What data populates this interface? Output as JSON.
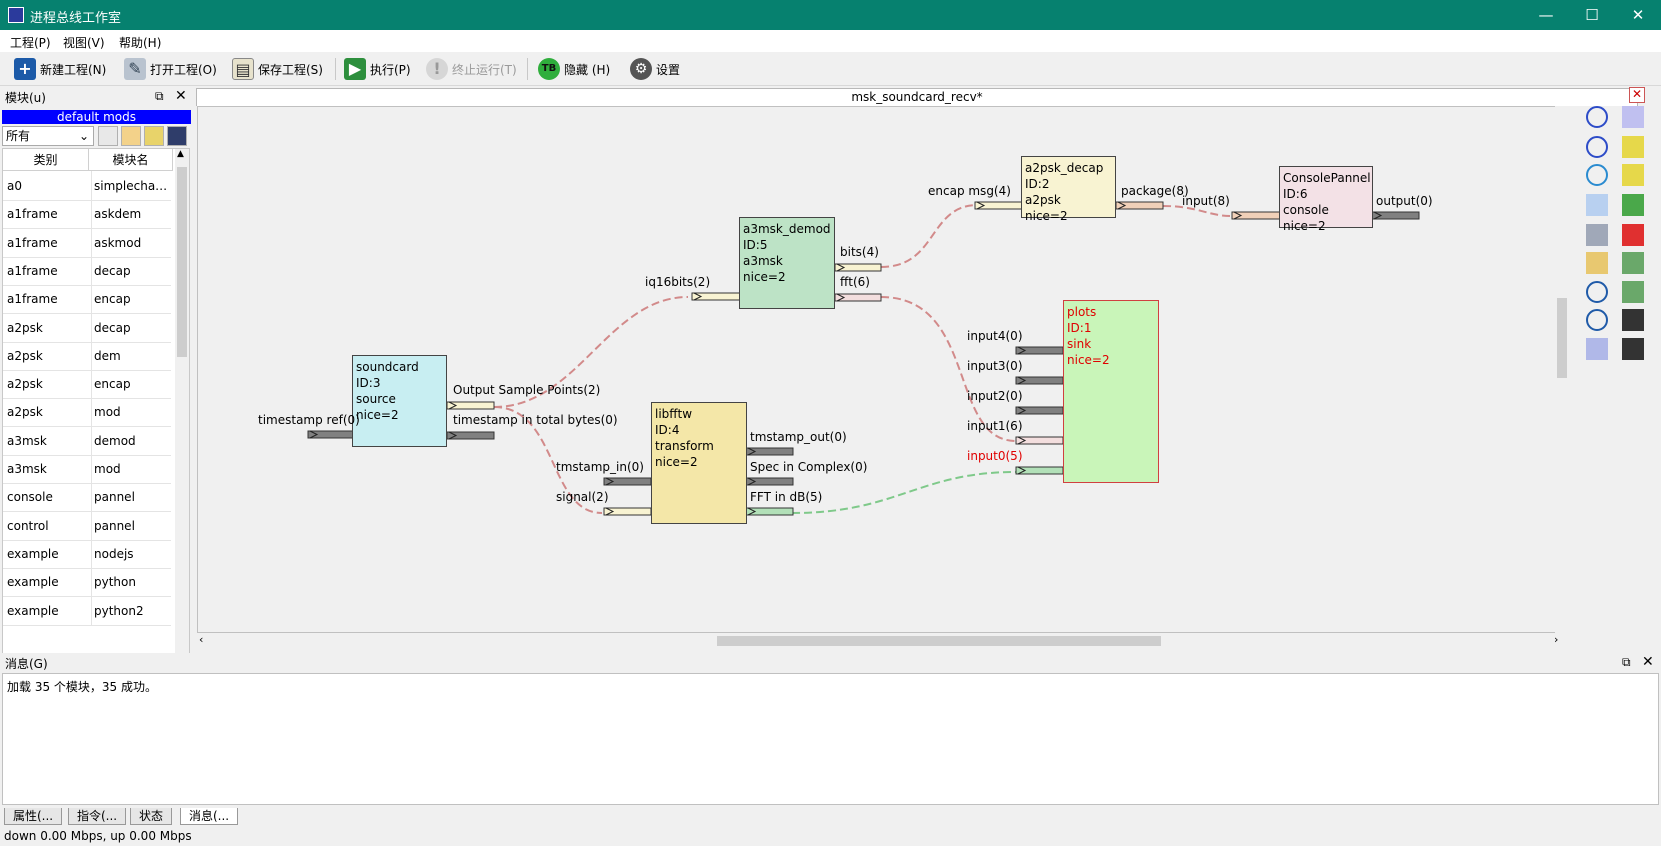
{
  "window": {
    "title": "进程总线工作室"
  },
  "menu": [
    "工程(P)",
    "视图(V)",
    "帮助(H)"
  ],
  "toolbar": {
    "new": "新建工程(N)",
    "open": "打开工程(O)",
    "save": "保存工程(S)",
    "run": "执行(P)",
    "stop": "终止运行(T)",
    "hide_icon_text": "TB",
    "hide": "隐藏  (H)",
    "settings": "设置"
  },
  "leftdock": {
    "title": "模块(u)",
    "group": "default mods",
    "filter": "所有",
    "columns": [
      "类别",
      "模块名"
    ],
    "rows": [
      [
        "a0",
        "simplechan..."
      ],
      [
        "a1frame",
        "askdem"
      ],
      [
        "a1frame",
        "askmod"
      ],
      [
        "a1frame",
        "decap"
      ],
      [
        "a1frame",
        "encap"
      ],
      [
        "a2psk",
        "decap"
      ],
      [
        "a2psk",
        "dem"
      ],
      [
        "a2psk",
        "encap"
      ],
      [
        "a2psk",
        "mod"
      ],
      [
        "a3msk",
        "demod"
      ],
      [
        "a3msk",
        "mod"
      ],
      [
        "console",
        "pannel"
      ],
      [
        "control",
        "pannel"
      ],
      [
        "example",
        "nodejs"
      ],
      [
        "example",
        "python"
      ],
      [
        "example",
        "python2"
      ]
    ]
  },
  "editor": {
    "tab_title": "msk_soundcard_recv*",
    "nodes": {
      "soundcard": [
        "soundcard",
        "ID:3",
        "source",
        "nice=2"
      ],
      "a3msk": [
        "a3msk_demod",
        "ID:5",
        "a3msk",
        "nice=2"
      ],
      "a2psk": [
        "a2psk_decap",
        "ID:2",
        "a2psk",
        "nice=2"
      ],
      "console": [
        "ConsolePannel",
        "ID:6",
        "console",
        "nice=2"
      ],
      "libfftw": [
        "libfftw",
        "ID:4",
        "transform",
        "nice=2"
      ],
      "plots": [
        "plots",
        "ID:1",
        "sink",
        "nice=2"
      ]
    },
    "ports": {
      "sc_in": "timestamp ref(0)",
      "sc_out1": "Output Sample Points(2)",
      "sc_out2": "timestamp in total bytes(0)",
      "a3_in": "iq16bits(2)",
      "a3_out1": "bits(4)",
      "a3_out2": "fft(6)",
      "a2_in": "encap msg(4)",
      "a2_out": "package(8)",
      "cp_in": "input(8)",
      "cp_out": "output(0)",
      "fft_in1": "tmstamp_in(0)",
      "fft_in2": "signal(2)",
      "fft_out1": "tmstamp_out(0)",
      "fft_out2": "Spec in Complex(0)",
      "fft_out3": "FFT in dB(5)",
      "pl_in4": "input4(0)",
      "pl_in3": "input3(0)",
      "pl_in2": "input2(0)",
      "pl_in1": "input1(6)",
      "pl_in0": "input0(5)"
    }
  },
  "messages": {
    "title": "消息(G)",
    "text": "加载 35 个模块，35 成功。"
  },
  "bottom_tabs": [
    "属性(...",
    "指令(...",
    "状态",
    "消息(..."
  ],
  "status": "down 0.00 Mbps, up 0.00 Mbps",
  "colors": {
    "titlebar": "#06816f",
    "soundcard": "#c8eef2",
    "a3msk": "#bde3c6",
    "a2psk": "#f8f3d2",
    "console": "#f3e1e6",
    "libfftw": "#f4e7a8",
    "plots": "#c9f5b9",
    "plots_text": "#e00000"
  }
}
